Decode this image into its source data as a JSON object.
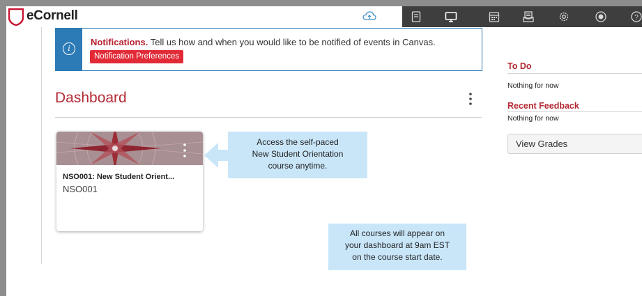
{
  "app": {
    "logo_text": "eCornell"
  },
  "toolbar": {
    "icons": [
      "cloud-icon",
      "book-icon",
      "monitor-icon",
      "calendar-icon",
      "inbox-icon",
      "gear-icon",
      "record-icon",
      "help-icon"
    ]
  },
  "notification": {
    "title": "Notifications.",
    "message": " Tell us how and when you would like to be notified of events in Canvas.",
    "button_label": "Notification Preferences"
  },
  "dashboard": {
    "title": "Dashboard"
  },
  "course_card": {
    "title": "NSO001: New Student Orient...",
    "code": "NSO001"
  },
  "callouts": {
    "first": [
      "Access the self-paced",
      "New Student Orientation",
      "course anytime."
    ],
    "second": [
      "All courses will appear on",
      "your dashboard at 9am EST",
      "on the course start date."
    ]
  },
  "sidebar": {
    "todo_heading": "To Do",
    "todo_text": "Nothing for now",
    "feedback_heading": "Recent Feedback",
    "feedback_text": "Nothing for now",
    "view_grades_label": "View Grades"
  },
  "colors": {
    "brand_red": "#b32a34",
    "info_blue": "#2d7bb6",
    "callout_blue": "#c9e6f9",
    "toolbar_dark": "#3e3e3e"
  }
}
